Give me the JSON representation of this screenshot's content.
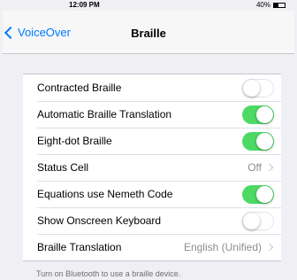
{
  "status_bar": {
    "time": "12:09 PM",
    "battery": "40%",
    "battery_level": 0.4
  },
  "nav": {
    "back_label": "VoiceOver",
    "title": "Braille"
  },
  "settings": [
    {
      "label": "Contracted Braille",
      "type": "toggle",
      "on": false
    },
    {
      "label": "Automatic Braille Translation",
      "type": "toggle",
      "on": true
    },
    {
      "label": "Eight-dot Braille",
      "type": "toggle",
      "on": true
    },
    {
      "label": "Status Cell",
      "type": "detail",
      "value": "Off"
    },
    {
      "label": "Equations use Nemeth Code",
      "type": "toggle",
      "on": true
    },
    {
      "label": "Show Onscreen Keyboard",
      "type": "toggle",
      "on": false
    },
    {
      "label": "Braille Translation",
      "type": "detail",
      "value": "English (Unified)"
    }
  ],
  "footer_note": "Turn on Bluetooth to use a braille device."
}
